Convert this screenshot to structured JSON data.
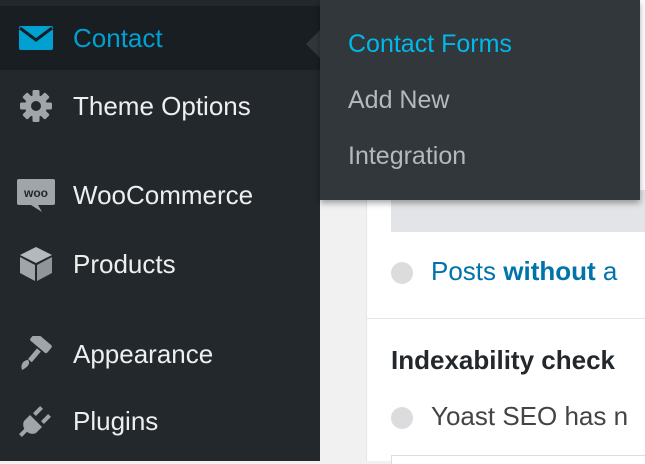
{
  "sidebar": {
    "items": [
      {
        "label": "Contact",
        "icon": "envelope-icon",
        "active": true
      },
      {
        "label": "Theme Options",
        "icon": "gear-icon"
      },
      {
        "label": "WooCommerce",
        "icon": "woocommerce-icon"
      },
      {
        "label": "Products",
        "icon": "box-icon"
      },
      {
        "label": "Appearance",
        "icon": "paintbrush-icon"
      },
      {
        "label": "Plugins",
        "icon": "plug-icon"
      }
    ]
  },
  "flyout": {
    "items": [
      {
        "label": "Contact Forms",
        "current": true
      },
      {
        "label": "Add New"
      },
      {
        "label": "Integration"
      }
    ]
  },
  "content": {
    "posts_prefix": "Posts ",
    "posts_bold": "without",
    "posts_suffix": " a",
    "indexability_heading": "Indexability check",
    "yoast_text": "Yoast SEO has n",
    "woo_icon_text": "woo"
  },
  "colors": {
    "sidebar_bg": "#23282d",
    "active_bg": "#191e23",
    "accent": "#00a0d2",
    "flyout_bg": "#32373c",
    "link": "#0073aa"
  }
}
